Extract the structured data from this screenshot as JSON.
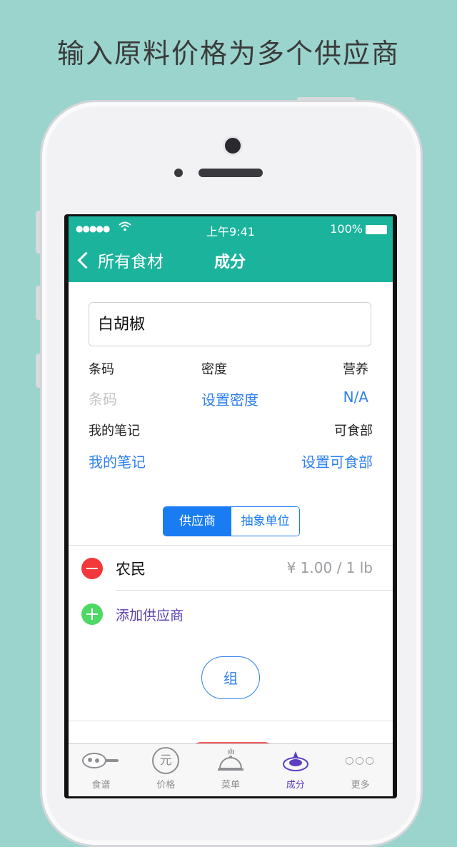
{
  "headline": "输入原料价格为多个供应商",
  "status": {
    "signal": "●●●●●",
    "time": "上午9:41",
    "battery": "100%"
  },
  "nav": {
    "back_label": "所有食材",
    "title": "成分"
  },
  "ingredient": {
    "name": "白胡椒"
  },
  "fields": {
    "barcode_label": "条码",
    "barcode_placeholder": "条码",
    "density_label": "密度",
    "density_value": "设置密度",
    "nutrition_label": "营养",
    "nutrition_value": "N/A",
    "notes_label": "我的笔记",
    "notes_value": "我的笔记",
    "edible_label": "可食部",
    "edible_value": "设置可食部"
  },
  "segment": {
    "options": [
      "供应商",
      "抽象单位"
    ],
    "selected": 0
  },
  "suppliers": [
    {
      "name": "农民",
      "price": "¥ 1.00 / 1 lb"
    }
  ],
  "add_supplier_label": "添加供应商",
  "group_button": "组",
  "tabs": [
    {
      "label": "食谱",
      "icon": "pan-icon"
    },
    {
      "label": "价格",
      "icon": "yuan-icon",
      "glyph": "元"
    },
    {
      "label": "菜单",
      "icon": "cloche-icon"
    },
    {
      "label": "成分",
      "icon": "ingredient-icon",
      "active": true
    },
    {
      "label": "更多",
      "icon": "more-icon",
      "glyph": "○○○"
    }
  ],
  "colors": {
    "accent": "#1bb39c",
    "link": "#2f80ed",
    "tab_active": "#5b3fc0",
    "delete": "#f2383a",
    "add": "#4cd964"
  }
}
